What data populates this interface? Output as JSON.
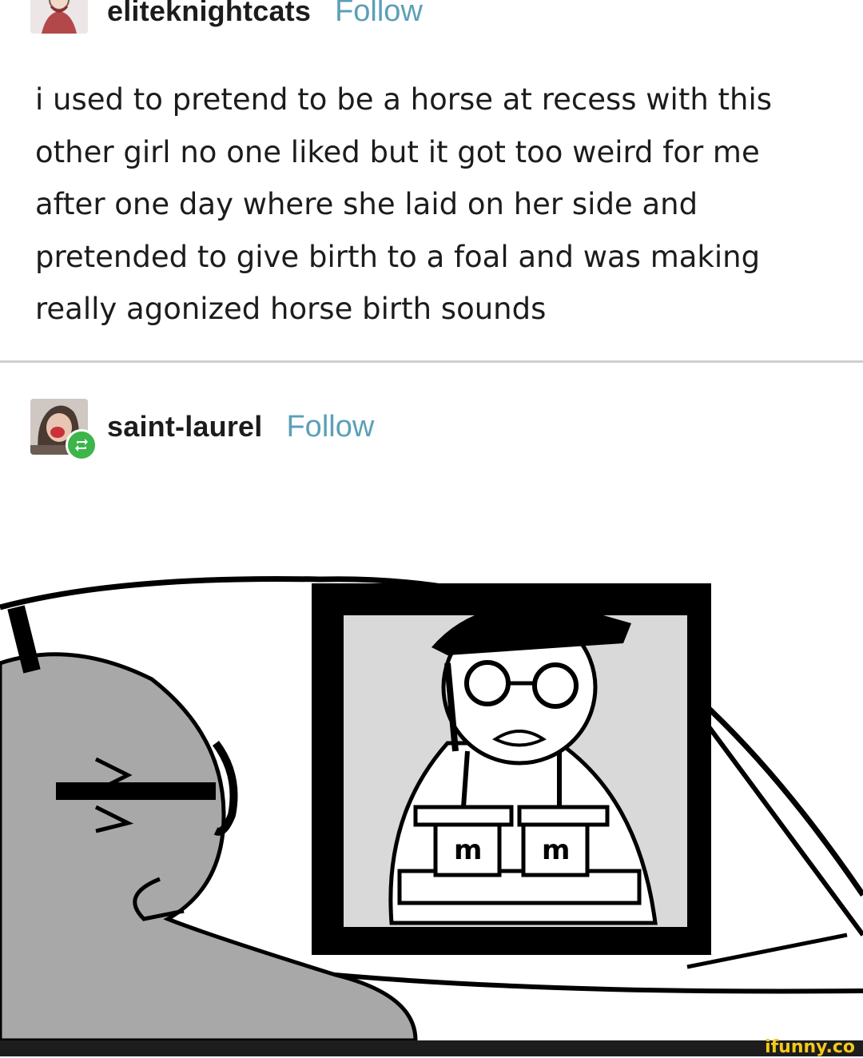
{
  "post1": {
    "username": "eliteknightcats",
    "follow_label": "Follow",
    "text": "i used to pretend to be a horse at recess with this other girl no one liked but it got too weird for me after one day where she laid on her side and pretended to give birth to a foal and was making really agonized horse birth sounds"
  },
  "post2": {
    "username": "saint-laurel",
    "follow_label": "Follow",
    "reblog_icon": "reblog-icon"
  },
  "comic": {
    "cup_label_left": "m",
    "cup_label_right": "m"
  },
  "footer": {
    "watermark": "ifunny.co"
  },
  "colors": {
    "follow": "#5b9fb8",
    "reblog_badge": "#3cb54a",
    "comic_gray": "#a8a8a8",
    "watermark": "#f4c81c"
  }
}
